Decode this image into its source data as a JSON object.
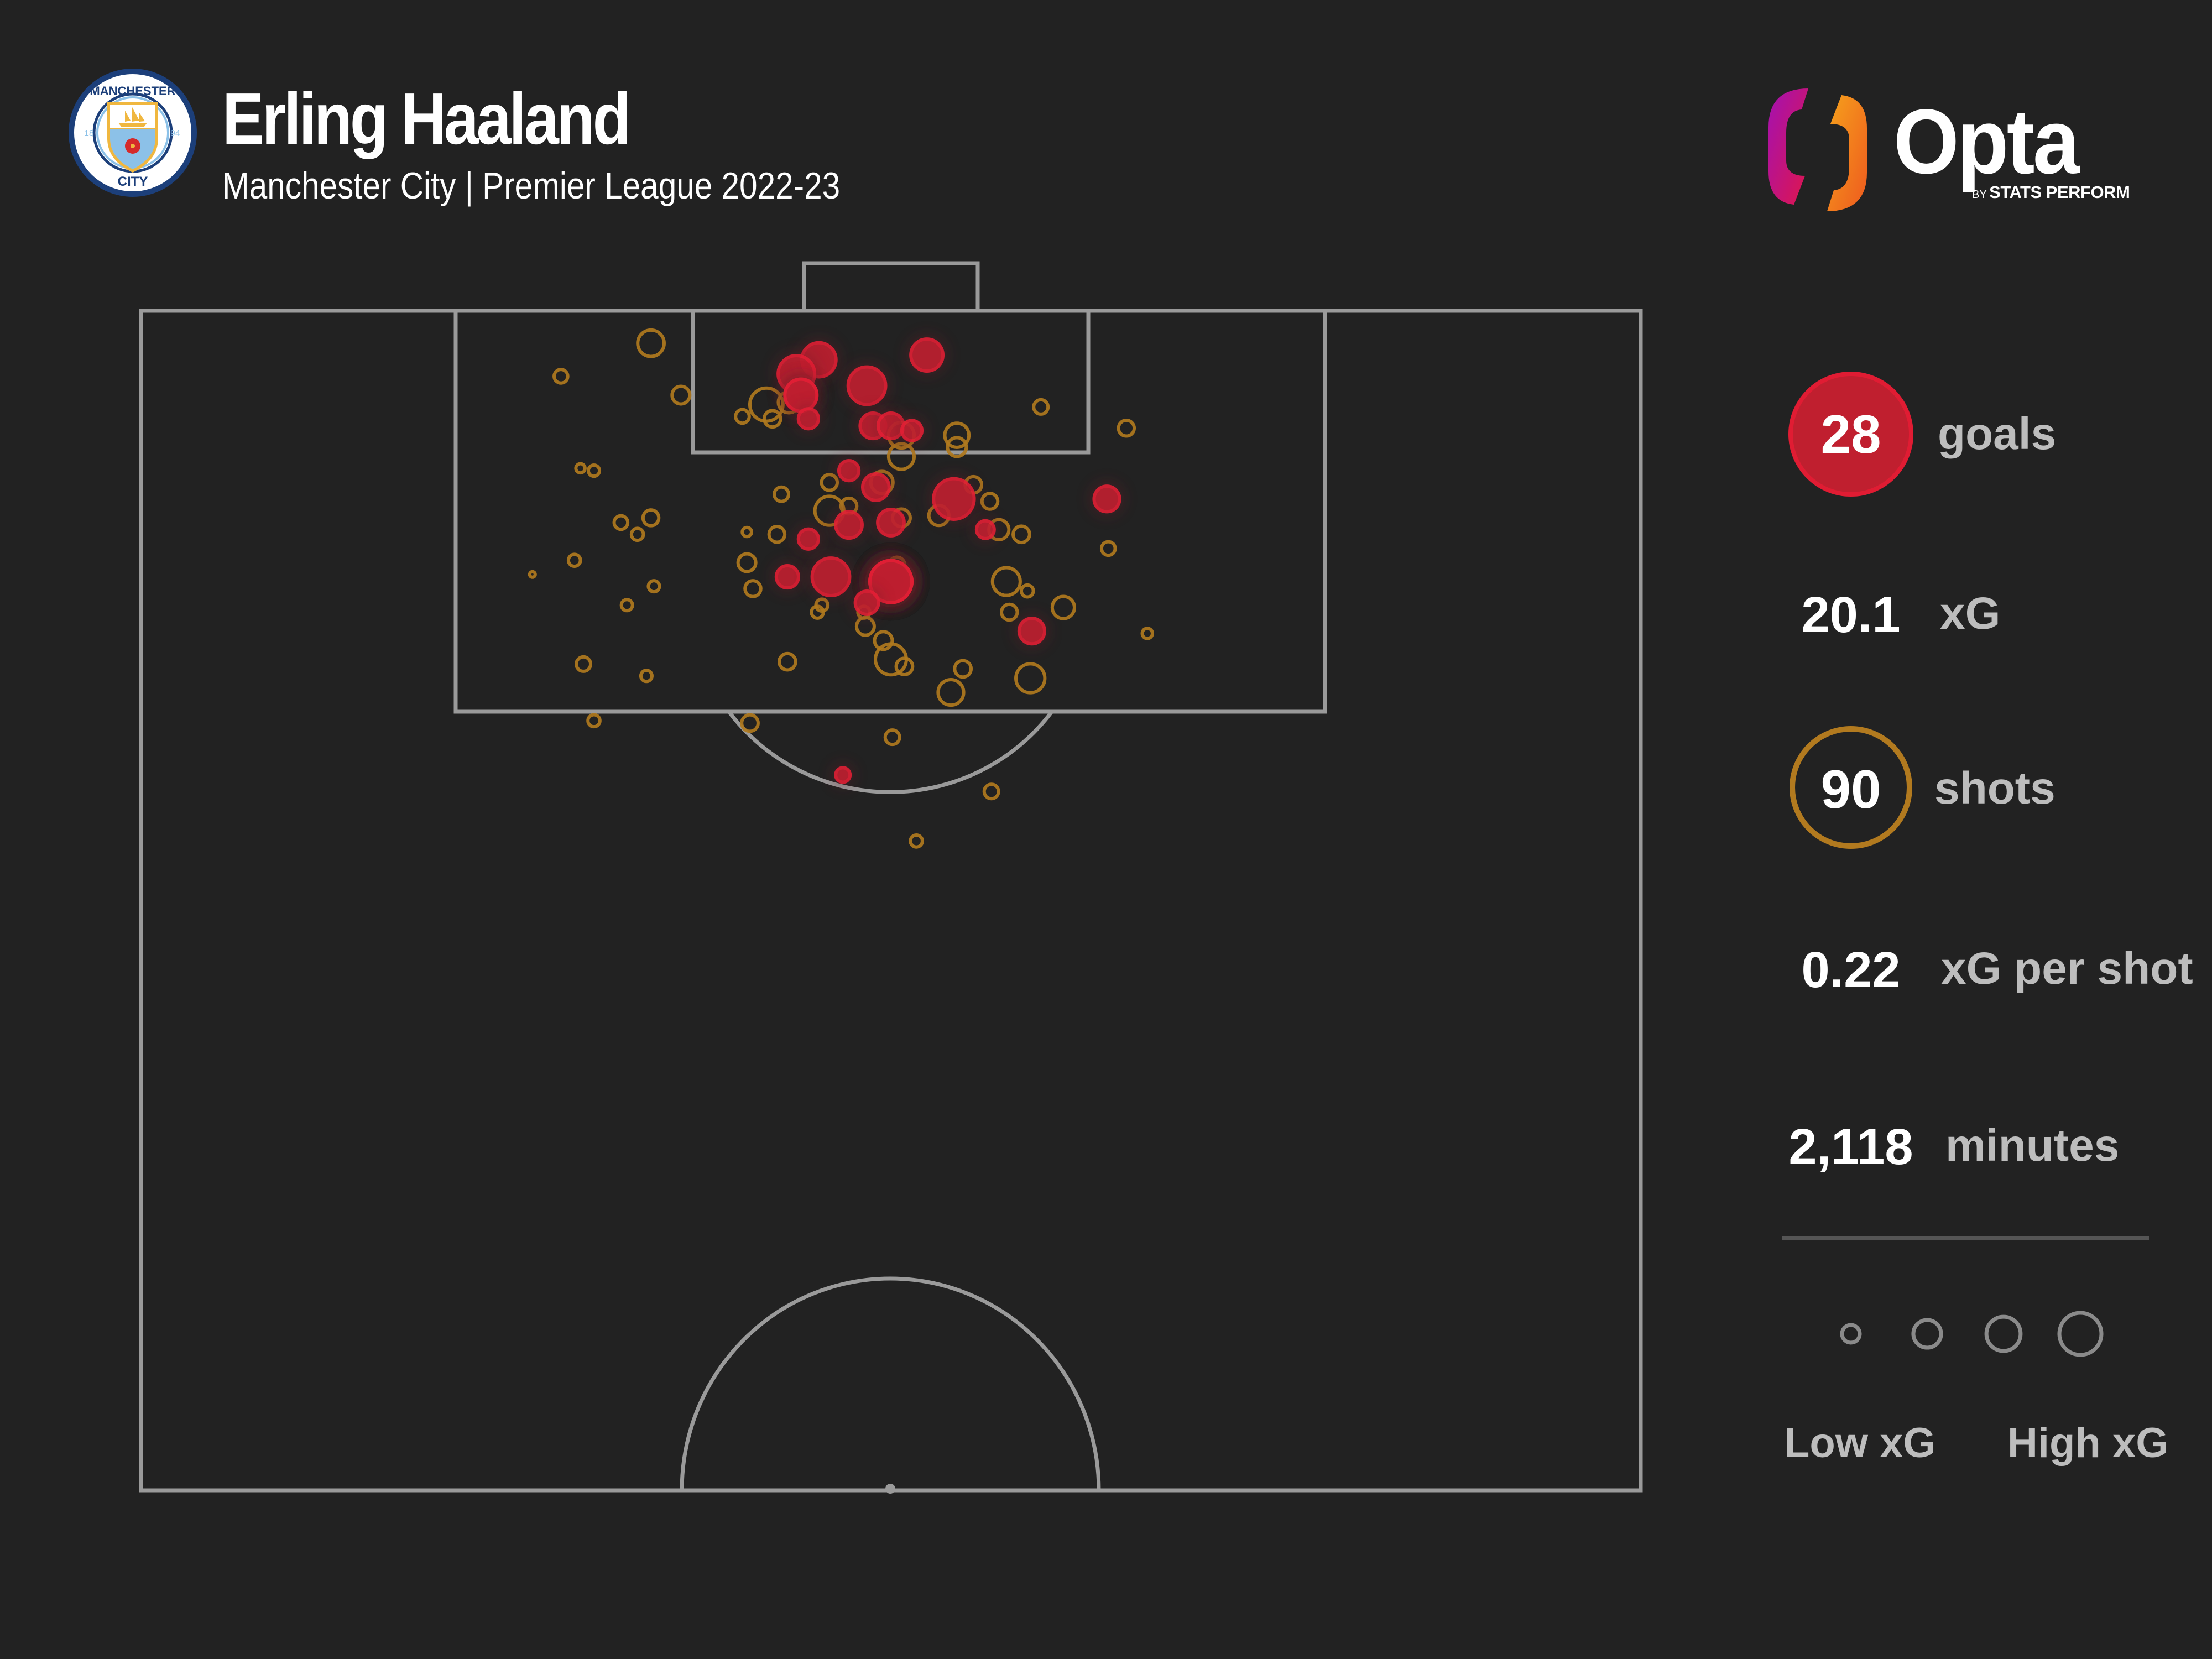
{
  "header": {
    "player_name": "Erling Haaland",
    "subtitle": "Manchester City | Premier League 2022-23",
    "club_badge": {
      "ring_text_top": "MANCHESTER",
      "ring_text_bottom": "CITY",
      "year_left": "18",
      "year_right": "94",
      "colors": {
        "navy": "#1c3f7a",
        "sky": "#8cc1e8",
        "gold": "#f0b73f",
        "rose": "#d52a2a"
      }
    }
  },
  "brand": {
    "wordmark": "Opta",
    "by": "BY",
    "sub": "STATS PERFORM",
    "gradient": [
      "#a311b2",
      "#e0164b",
      "#f6a21c",
      "#ee6a1e"
    ]
  },
  "stats": {
    "goals": {
      "value": "28",
      "label": "goals"
    },
    "xg": {
      "value": "20.1",
      "label": "xG"
    },
    "shots": {
      "value": "90",
      "label": "shots"
    },
    "xg_per_shot": {
      "value": "0.22",
      "label": "xG per shot"
    },
    "minutes": {
      "value": "2,118",
      "label": "minutes"
    }
  },
  "legend": {
    "low_label": "Low xG",
    "high_label": "High xG",
    "sample_xg": [
      0.17,
      0.37,
      0.54,
      0.79
    ]
  },
  "colors": {
    "background": "#222222",
    "pitch_lines": "#9a9a9a",
    "goal_fill": "#c21f30",
    "goal_stroke": "#e41f35",
    "miss_stroke": "#b07a1e",
    "legend_stroke": "#8a8a8a",
    "text_primary": "#ffffff",
    "text_secondary": "#bdbdbd"
  },
  "chart_data": {
    "type": "scatter",
    "title": "Erling Haaland",
    "subtitle": "Manchester City | Premier League 2022-23",
    "coordinate_system": "Opta pitch units: x = lateral 0-100 (left to right), y = distance from attacking goal line 0-50 (half pitch)",
    "xlim": [
      0,
      100
    ],
    "ylim": [
      0,
      50
    ],
    "grid": false,
    "size_encoding": "xG (circle area proportional to xG)",
    "legend": {
      "position": "right",
      "entries": [
        "Low xG",
        "High xG"
      ]
    },
    "series": [
      {
        "name": "goals",
        "style": "filled-red",
        "points": [
          {
            "x": 45.2,
            "y": 2.1,
            "xg": 0.54
          },
          {
            "x": 43.7,
            "y": 2.7,
            "xg": 0.61
          },
          {
            "x": 44.0,
            "y": 3.6,
            "xg": 0.48
          },
          {
            "x": 44.0,
            "y": 3.6,
            "xg": 0.48
          },
          {
            "x": 44.5,
            "y": 4.6,
            "xg": 0.21
          },
          {
            "x": 48.4,
            "y": 3.2,
            "xg": 0.64
          },
          {
            "x": 52.4,
            "y": 1.9,
            "xg": 0.48
          },
          {
            "x": 48.8,
            "y": 4.9,
            "xg": 0.32
          },
          {
            "x": 50.0,
            "y": 4.9,
            "xg": 0.32
          },
          {
            "x": 51.4,
            "y": 5.1,
            "xg": 0.21
          },
          {
            "x": 47.2,
            "y": 6.8,
            "xg": 0.21
          },
          {
            "x": 49.0,
            "y": 7.5,
            "xg": 0.34
          },
          {
            "x": 47.2,
            "y": 9.1,
            "xg": 0.34
          },
          {
            "x": 50.0,
            "y": 9.0,
            "xg": 0.34
          },
          {
            "x": 54.2,
            "y": 8.0,
            "xg": 0.74
          },
          {
            "x": 56.3,
            "y": 9.3,
            "xg": 0.17
          },
          {
            "x": 44.5,
            "y": 9.7,
            "xg": 0.21
          },
          {
            "x": 43.1,
            "y": 11.3,
            "xg": 0.25
          },
          {
            "x": 46.0,
            "y": 11.3,
            "xg": 0.64
          },
          {
            "x": 50.0,
            "y": 11.5,
            "xg": 0.79
          },
          {
            "x": 50.0,
            "y": 11.5,
            "xg": 0.79
          },
          {
            "x": 50.0,
            "y": 11.5,
            "xg": 0.79
          },
          {
            "x": 50.0,
            "y": 11.5,
            "xg": 0.79
          },
          {
            "x": 50.0,
            "y": 11.5,
            "xg": 0.79
          },
          {
            "x": 64.4,
            "y": 8.0,
            "xg": 0.32
          },
          {
            "x": 48.4,
            "y": 12.4,
            "xg": 0.27
          },
          {
            "x": 59.4,
            "y": 13.6,
            "xg": 0.32
          },
          {
            "x": 46.8,
            "y": 19.7,
            "xg": 0.12
          }
        ]
      },
      {
        "name": "non-goal shots",
        "style": "outlined-gold",
        "points": [
          {
            "x": 34.0,
            "y": 1.4,
            "xg": 0.34
          },
          {
            "x": 28.0,
            "y": 2.8,
            "xg": 0.11
          },
          {
            "x": 36.0,
            "y": 3.6,
            "xg": 0.17
          },
          {
            "x": 41.7,
            "y": 4.0,
            "xg": 0.51
          },
          {
            "x": 40.1,
            "y": 4.5,
            "xg": 0.11
          },
          {
            "x": 42.1,
            "y": 4.6,
            "xg": 0.15
          },
          {
            "x": 43.2,
            "y": 3.9,
            "xg": 0.23
          },
          {
            "x": 29.3,
            "y": 6.7,
            "xg": 0.06
          },
          {
            "x": 30.2,
            "y": 6.8,
            "xg": 0.08
          },
          {
            "x": 45.9,
            "y": 7.3,
            "xg": 0.14
          },
          {
            "x": 42.7,
            "y": 7.8,
            "xg": 0.12
          },
          {
            "x": 45.9,
            "y": 8.5,
            "xg": 0.4
          },
          {
            "x": 47.2,
            "y": 8.3,
            "xg": 0.14
          },
          {
            "x": 32.0,
            "y": 9.0,
            "xg": 0.11
          },
          {
            "x": 34.0,
            "y": 8.8,
            "xg": 0.14
          },
          {
            "x": 33.1,
            "y": 9.5,
            "xg": 0.09
          },
          {
            "x": 40.4,
            "y": 9.4,
            "xg": 0.06
          },
          {
            "x": 42.4,
            "y": 9.5,
            "xg": 0.14
          },
          {
            "x": 28.9,
            "y": 10.6,
            "xg": 0.09
          },
          {
            "x": 26.1,
            "y": 11.2,
            "xg": 0.03
          },
          {
            "x": 40.4,
            "y": 10.7,
            "xg": 0.17
          },
          {
            "x": 34.2,
            "y": 11.7,
            "xg": 0.08
          },
          {
            "x": 40.8,
            "y": 11.8,
            "xg": 0.14
          },
          {
            "x": 32.4,
            "y": 12.5,
            "xg": 0.08
          },
          {
            "x": 45.4,
            "y": 12.5,
            "xg": 0.09
          },
          {
            "x": 45.1,
            "y": 12.8,
            "xg": 0.09
          },
          {
            "x": 48.2,
            "y": 12.8,
            "xg": 0.09
          },
          {
            "x": 48.3,
            "y": 13.4,
            "xg": 0.17
          },
          {
            "x": 49.5,
            "y": 14.0,
            "xg": 0.17
          },
          {
            "x": 50.0,
            "y": 14.8,
            "xg": 0.45
          },
          {
            "x": 50.9,
            "y": 15.1,
            "xg": 0.15
          },
          {
            "x": 29.5,
            "y": 15.0,
            "xg": 0.12
          },
          {
            "x": 33.7,
            "y": 15.5,
            "xg": 0.08
          },
          {
            "x": 43.1,
            "y": 14.9,
            "xg": 0.15
          },
          {
            "x": 60.0,
            "y": 4.1,
            "xg": 0.12
          },
          {
            "x": 65.7,
            "y": 5.0,
            "xg": 0.14
          },
          {
            "x": 50.7,
            "y": 5.3,
            "xg": 0.32
          },
          {
            "x": 54.4,
            "y": 5.3,
            "xg": 0.29
          },
          {
            "x": 54.4,
            "y": 5.8,
            "xg": 0.19
          },
          {
            "x": 50.7,
            "y": 6.2,
            "xg": 0.32
          },
          {
            "x": 49.4,
            "y": 7.3,
            "xg": 0.25
          },
          {
            "x": 55.5,
            "y": 7.4,
            "xg": 0.15
          },
          {
            "x": 56.6,
            "y": 8.1,
            "xg": 0.14
          },
          {
            "x": 53.2,
            "y": 8.7,
            "xg": 0.21
          },
          {
            "x": 50.7,
            "y": 8.8,
            "xg": 0.17
          },
          {
            "x": 57.2,
            "y": 9.3,
            "xg": 0.21
          },
          {
            "x": 58.7,
            "y": 9.5,
            "xg": 0.15
          },
          {
            "x": 64.5,
            "y": 10.1,
            "xg": 0.11
          },
          {
            "x": 50.4,
            "y": 10.8,
            "xg": 0.14
          },
          {
            "x": 57.7,
            "y": 11.5,
            "xg": 0.37
          },
          {
            "x": 59.1,
            "y": 11.9,
            "xg": 0.09
          },
          {
            "x": 57.9,
            "y": 12.8,
            "xg": 0.14
          },
          {
            "x": 61.5,
            "y": 12.6,
            "xg": 0.25
          },
          {
            "x": 67.1,
            "y": 13.7,
            "xg": 0.07
          },
          {
            "x": 54.8,
            "y": 15.2,
            "xg": 0.15
          },
          {
            "x": 54.0,
            "y": 16.2,
            "xg": 0.32
          },
          {
            "x": 59.3,
            "y": 15.6,
            "xg": 0.4
          },
          {
            "x": 30.2,
            "y": 17.4,
            "xg": 0.09
          },
          {
            "x": 40.6,
            "y": 17.5,
            "xg": 0.15
          },
          {
            "x": 50.1,
            "y": 18.1,
            "xg": 0.12
          },
          {
            "x": 56.7,
            "y": 20.4,
            "xg": 0.12
          },
          {
            "x": 51.7,
            "y": 22.5,
            "xg": 0.09
          }
        ]
      }
    ]
  }
}
